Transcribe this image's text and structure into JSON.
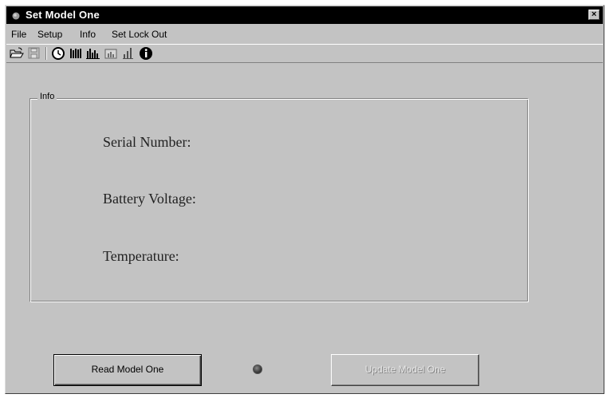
{
  "window": {
    "title": "Set Model One",
    "close_symbol": "×"
  },
  "menu": {
    "items": [
      {
        "label": "File"
      },
      {
        "label": "Setup"
      },
      {
        "label": "Info"
      },
      {
        "label": "Set Lock Out"
      }
    ]
  },
  "toolbar": {
    "icons": [
      "open-folder-icon",
      "save-icon",
      "clock-icon",
      "bar-chart-icon",
      "grouped-bar-chart-icon",
      "chart-window-icon",
      "level-bars-icon",
      "info-icon"
    ]
  },
  "info_group": {
    "legend": "Info",
    "serial_number_label": "Serial Number:",
    "battery_voltage_label": "Battery Voltage:",
    "temperature_label": "Temperature:"
  },
  "buttons": {
    "read_label": "Read Model One",
    "update_label": "Update Model One",
    "update_enabled": false
  },
  "status_led": {
    "color": "#3a3a3a",
    "state": "off"
  }
}
